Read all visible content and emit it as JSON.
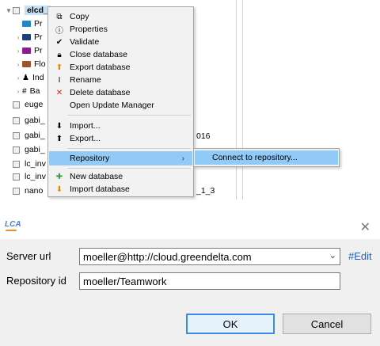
{
  "tree": {
    "root_label": "elcd_",
    "items": [
      {
        "label": "Pr",
        "icon": "folder-icon",
        "color": "#1e88c9"
      },
      {
        "label": "Pr",
        "icon": "folder-icon",
        "color": "#1f3f7a"
      },
      {
        "label": "Pr",
        "icon": "folder-icon",
        "color": "#8b1e8e"
      },
      {
        "label": "Flo",
        "icon": "folder-icon",
        "color": "#a0522d"
      },
      {
        "label": "Ind",
        "icon": "person-icon",
        "color": "#222222"
      },
      {
        "label": "Ba",
        "icon": "grid-icon",
        "color": "#444444"
      }
    ],
    "databases": [
      "euge",
      "gabi_",
      "gabi_",
      "gabi_",
      "lc_inv",
      "lc_inv",
      "nano"
    ],
    "tail_texts": [
      "016",
      "_1_3"
    ]
  },
  "context_menu": {
    "items": [
      {
        "label": "Copy",
        "icon": "copy-icon"
      },
      {
        "label": "Properties",
        "icon": "info-icon"
      },
      {
        "label": "Validate",
        "icon": "check-icon"
      },
      {
        "label": "Close database",
        "icon": "lock-icon"
      },
      {
        "label": "Export database",
        "icon": "export-icon"
      },
      {
        "label": "Rename",
        "icon": "text-cursor-icon"
      },
      {
        "label": "Delete database",
        "icon": "delete-icon"
      },
      {
        "label": "Open Update Manager",
        "icon": ""
      },
      {
        "label": "Import...",
        "icon": "import-icon"
      },
      {
        "label": "Export...",
        "icon": "export-icon"
      },
      {
        "label": "Repository",
        "icon": ""
      },
      {
        "label": "New database",
        "icon": "new-database-icon"
      },
      {
        "label": "Import database",
        "icon": "import-database-icon"
      }
    ],
    "submenu_item": "Connect to repository..."
  },
  "dialog": {
    "logo_text": "LCA",
    "server_url_label": "Server url",
    "server_url_value": "moeller@http://cloud.greendelta.com",
    "edit_link": "#Edit",
    "repository_id_label": "Repository id",
    "repository_id_value": "moeller/Teamwork",
    "ok_label": "OK",
    "cancel_label": "Cancel"
  },
  "colors": {
    "highlight": "#91c9f7",
    "selection": "#c7e0f4",
    "link": "#1f5fbf",
    "ok_border": "#3c8be0"
  }
}
